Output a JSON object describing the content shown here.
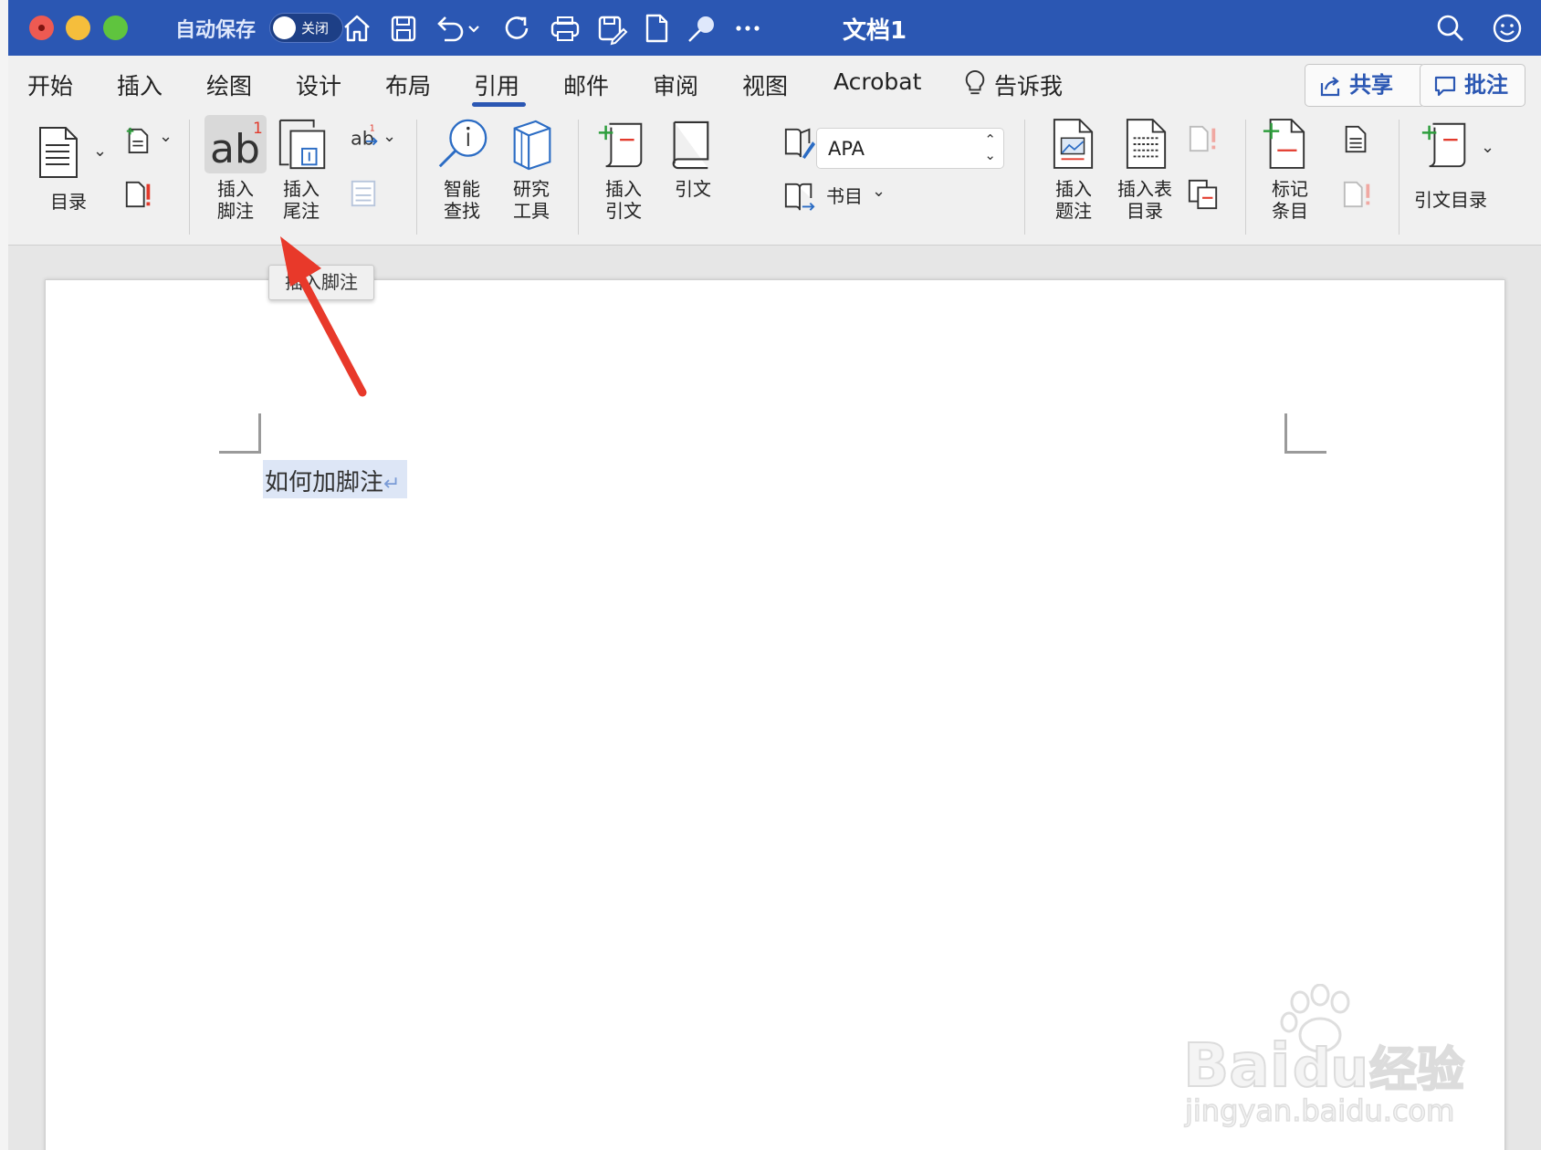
{
  "titlebar": {
    "autosave_label": "自动保存",
    "autosave_state": "关闭",
    "doc_title": "文档1",
    "icons": [
      "home-icon",
      "save-icon",
      "undo-icon",
      "undo-dropdown-icon",
      "redo-icon",
      "print-icon",
      "save-as-icon",
      "new-doc-icon",
      "pin-icon",
      "more-icon",
      "search-icon",
      "smiley-icon"
    ]
  },
  "tabs": [
    "开始",
    "插入",
    "绘图",
    "设计",
    "布局",
    "引用",
    "邮件",
    "审阅",
    "视图",
    "Acrobat",
    "告诉我"
  ],
  "active_tab": "引用",
  "share_label": "共享",
  "comments_label": "批注",
  "ribbon": {
    "toc_label": "目录",
    "insert_footnote_line1": "插入",
    "insert_footnote_line2": "脚注",
    "insert_endnote_line1": "插入",
    "insert_endnote_line2": "尾注",
    "smart_lookup_line1": "智能",
    "smart_lookup_line2": "查找",
    "researcher_line1": "研究",
    "researcher_line2": "工具",
    "insert_citation_line1": "插入",
    "insert_citation_line2": "引文",
    "citations_label": "引文",
    "citation_style": "APA",
    "bibliography_label": "书目",
    "insert_caption_line1": "插入",
    "insert_caption_line2": "题注",
    "table_of_figures_line1": "插入表",
    "table_of_figures_line2": "目录",
    "mark_entry_line1": "标记",
    "mark_entry_line2": "条目",
    "table_of_authorities_label": "引文目录"
  },
  "tooltip": "插入脚注",
  "document": {
    "text": "如何加脚注",
    "para_mark": "↵"
  },
  "colors": {
    "titlebar": "#2b57b3",
    "accent": "#2b57b3",
    "annotation_arrow": "#e8392a",
    "selection": "#dde6f6"
  }
}
